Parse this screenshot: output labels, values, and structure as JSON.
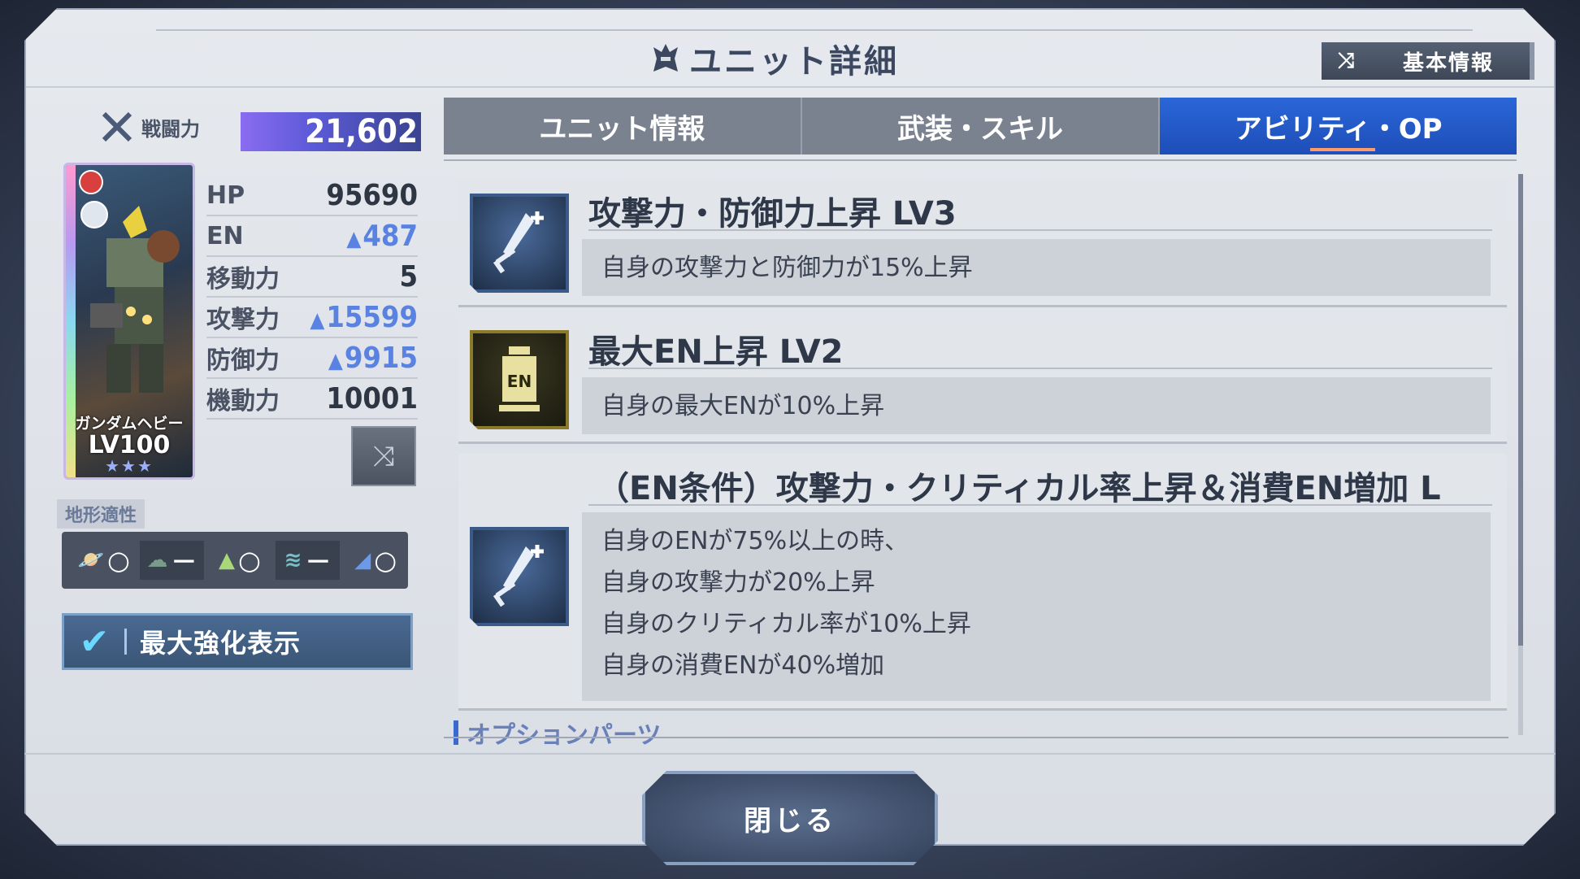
{
  "header": {
    "title": "ユニット詳細",
    "basic_info_button": "基本情報"
  },
  "unit": {
    "power_label": "戦闘力",
    "power_value": "21,602",
    "name": "ガンダムヘビー",
    "level": "LV100",
    "stars": "★★★",
    "stats": [
      {
        "name": "HP",
        "value": "95690",
        "boosted": false
      },
      {
        "name": "EN",
        "value": "487",
        "boosted": true
      },
      {
        "name": "移動力",
        "value": "5",
        "boosted": false
      },
      {
        "name": "攻撃力",
        "value": "15599",
        "boosted": true
      },
      {
        "name": "防御力",
        "value": "9915",
        "boosted": true
      },
      {
        "name": "機動力",
        "value": "10001",
        "boosted": false
      }
    ],
    "terrain_label": "地形適性",
    "terrain": [
      {
        "icon": "space-icon",
        "mark": "○",
        "dark": false
      },
      {
        "icon": "air-icon",
        "mark": "－",
        "dark": true
      },
      {
        "icon": "ground-icon",
        "mark": "○",
        "dark": false
      },
      {
        "icon": "water-icon",
        "mark": "－",
        "dark": true
      },
      {
        "icon": "underwater-icon",
        "mark": "○",
        "dark": false
      }
    ],
    "max_enhance_label": "最大強化表示",
    "max_enhance_checked": true
  },
  "tabs": [
    {
      "label": "ユニット情報",
      "active": false
    },
    {
      "label": "武装・スキル",
      "active": false
    },
    {
      "label": "アビリティ・OP",
      "active": true
    }
  ],
  "abilities": [
    {
      "icon": "sword-plus-icon",
      "name": "攻撃力・防御力上昇 LV3",
      "desc": [
        "自身の攻撃力と防御力が15%上昇"
      ]
    },
    {
      "icon": "en-tank-icon",
      "name": "最大EN上昇 LV2",
      "desc": [
        "自身の最大ENが10%上昇"
      ]
    },
    {
      "icon": "sword-plus-icon",
      "name": "（EN条件）攻撃力・クリティカル率上昇＆消費EN増加 L",
      "desc": [
        "自身のENが75%以上の時、",
        "自身の攻撃力が20%上昇",
        "自身のクリティカル率が10%上昇",
        "自身の消費ENが40%増加"
      ]
    }
  ],
  "option_parts_label": "オプションパーツ",
  "close_button": "閉じる",
  "colors": {
    "active_tab": "#2a66d8",
    "boost_blue": "#5a82e0",
    "power_bar": "#5c5ad8"
  }
}
